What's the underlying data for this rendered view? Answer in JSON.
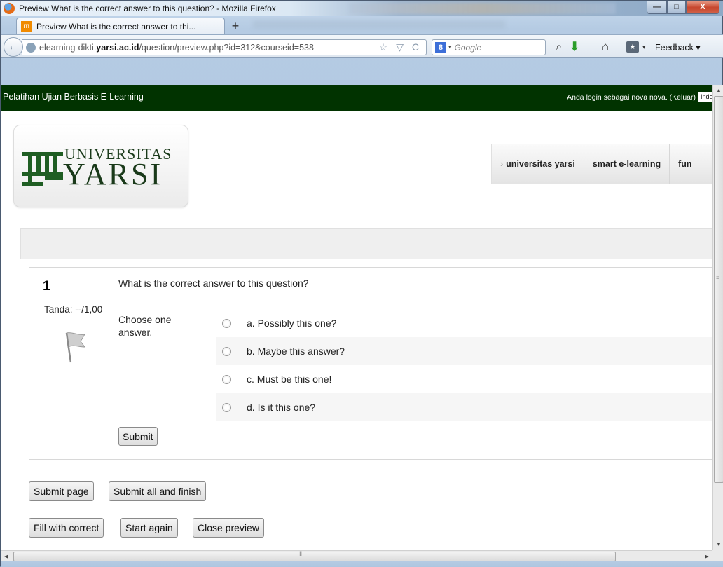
{
  "window": {
    "title": "Preview What is the correct answer to this question? - Mozilla Firefox",
    "min_label": "—",
    "max_label": "□",
    "close_label": "X"
  },
  "tab": {
    "label": "Preview What is the correct answer to thi...",
    "favicon": "m",
    "new_tab": "+"
  },
  "nav": {
    "url_prefix": "elearning-dikti.",
    "url_domain": "yarsi.ac.id",
    "url_path": "/question/preview.php?id=312&courseid=538",
    "url_icons": "☆ ▽ C",
    "search_engine_icon": "8",
    "search_placeholder": "Google",
    "feedback": "Feedback ▾"
  },
  "site": {
    "name": "Pelatihan Ujian Berbasis E-Learning",
    "login_text": "Anda login sebagai nova nova. (Keluar)",
    "lang": "Indonesia",
    "logo_line1": "UNIVERSITAS",
    "logo_line2": "YARSI",
    "nav_items": [
      {
        "label": "universitas yarsi"
      },
      {
        "label": "smart e-learning"
      },
      {
        "label": "fun"
      }
    ]
  },
  "question": {
    "number": "1",
    "mark": "Tanda: --/1,00",
    "text": "What is the correct answer to this question?",
    "prompt": "Choose one answer.",
    "answers": [
      {
        "label": "a. Possibly this one?"
      },
      {
        "label": "b. Maybe this answer?"
      },
      {
        "label": "c. Must be this one!"
      },
      {
        "label": "d. Is it this one?"
      }
    ],
    "submit_label": "Submit"
  },
  "actions": {
    "submit_page": "Submit page",
    "submit_all": "Submit all and finish",
    "fill_correct": "Fill with correct",
    "start_again": "Start again",
    "close_preview": "Close preview"
  },
  "colors": {
    "site_bar": "#013300",
    "accent": "#1a3a1a"
  }
}
